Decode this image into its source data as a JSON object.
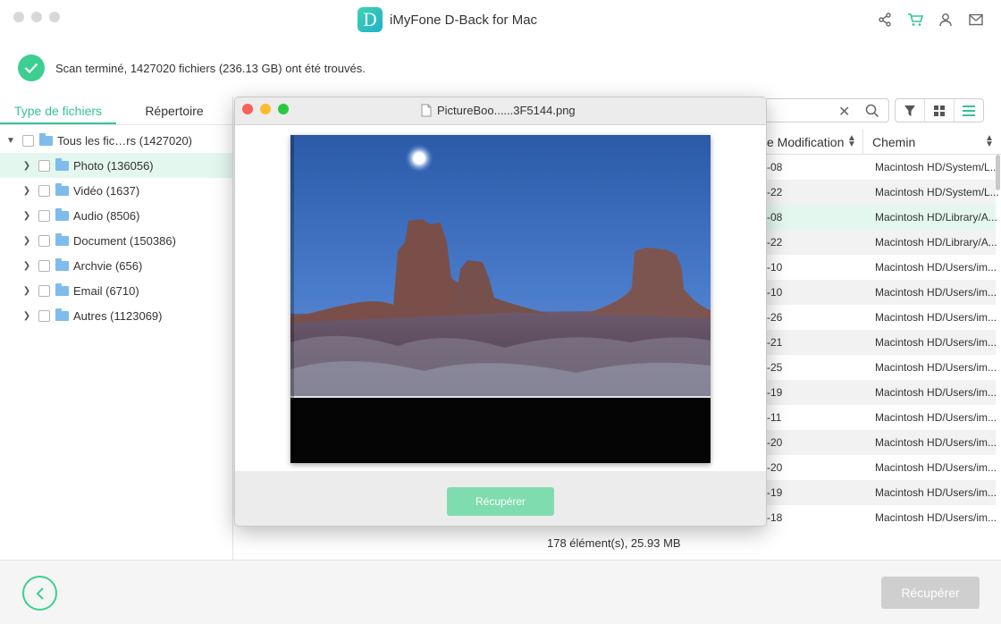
{
  "app": {
    "title": "iMyFone D-Back for Mac",
    "logo_letter": "D"
  },
  "banner": {
    "text": "Scan terminé, 1427020 fichiers (236.13 GB) ont été trouvés."
  },
  "sidebar": {
    "tabs": [
      {
        "label": "Type de fichiers"
      },
      {
        "label": "Répertoire"
      }
    ],
    "root": {
      "label": "Tous les fic…rs (1427020)"
    },
    "items": [
      {
        "label": "Photo (136056)"
      },
      {
        "label": "Vidéo (1637)"
      },
      {
        "label": "Audio (8506)"
      },
      {
        "label": "Document (150386)"
      },
      {
        "label": "Archvie (656)"
      },
      {
        "label": "Email (6710)"
      },
      {
        "label": "Autres (1123069)"
      }
    ]
  },
  "table": {
    "headers": {
      "modified": "e Modification",
      "path": "Chemin"
    },
    "rows": [
      {
        "date": "-08",
        "path": "Macintosh HD/System/L..."
      },
      {
        "date": "-22",
        "path": "Macintosh HD/System/L..."
      },
      {
        "date": "-08",
        "path": "Macintosh HD/Library/A..."
      },
      {
        "date": "-22",
        "path": "Macintosh HD/Library/A..."
      },
      {
        "date": "-10",
        "path": "Macintosh HD/Users/im..."
      },
      {
        "date": "-10",
        "path": "Macintosh HD/Users/im..."
      },
      {
        "date": "-26",
        "path": "Macintosh HD/Users/im..."
      },
      {
        "date": "-21",
        "path": "Macintosh HD/Users/im..."
      },
      {
        "date": "-25",
        "path": "Macintosh HD/Users/im..."
      },
      {
        "date": "-19",
        "path": "Macintosh HD/Users/im..."
      },
      {
        "date": "-11",
        "path": "Macintosh HD/Users/im..."
      },
      {
        "date": "-20",
        "path": "Macintosh HD/Users/im..."
      },
      {
        "date": "-20",
        "path": "Macintosh HD/Users/im..."
      },
      {
        "date": "-19",
        "path": "Macintosh HD/Users/im..."
      },
      {
        "date": "-18",
        "path": "Macintosh HD/Users/im..."
      }
    ],
    "footer": "178 élément(s), 25.93 MB"
  },
  "preview": {
    "filename": "PictureBoo......3F5144.png",
    "recover_label": "Récupérer"
  },
  "bottom": {
    "recover_label": "Récupérer"
  },
  "colors": {
    "accent": "#33c591",
    "selected_bg": "#e3f7ef",
    "disabled": "#cfcfcf"
  }
}
